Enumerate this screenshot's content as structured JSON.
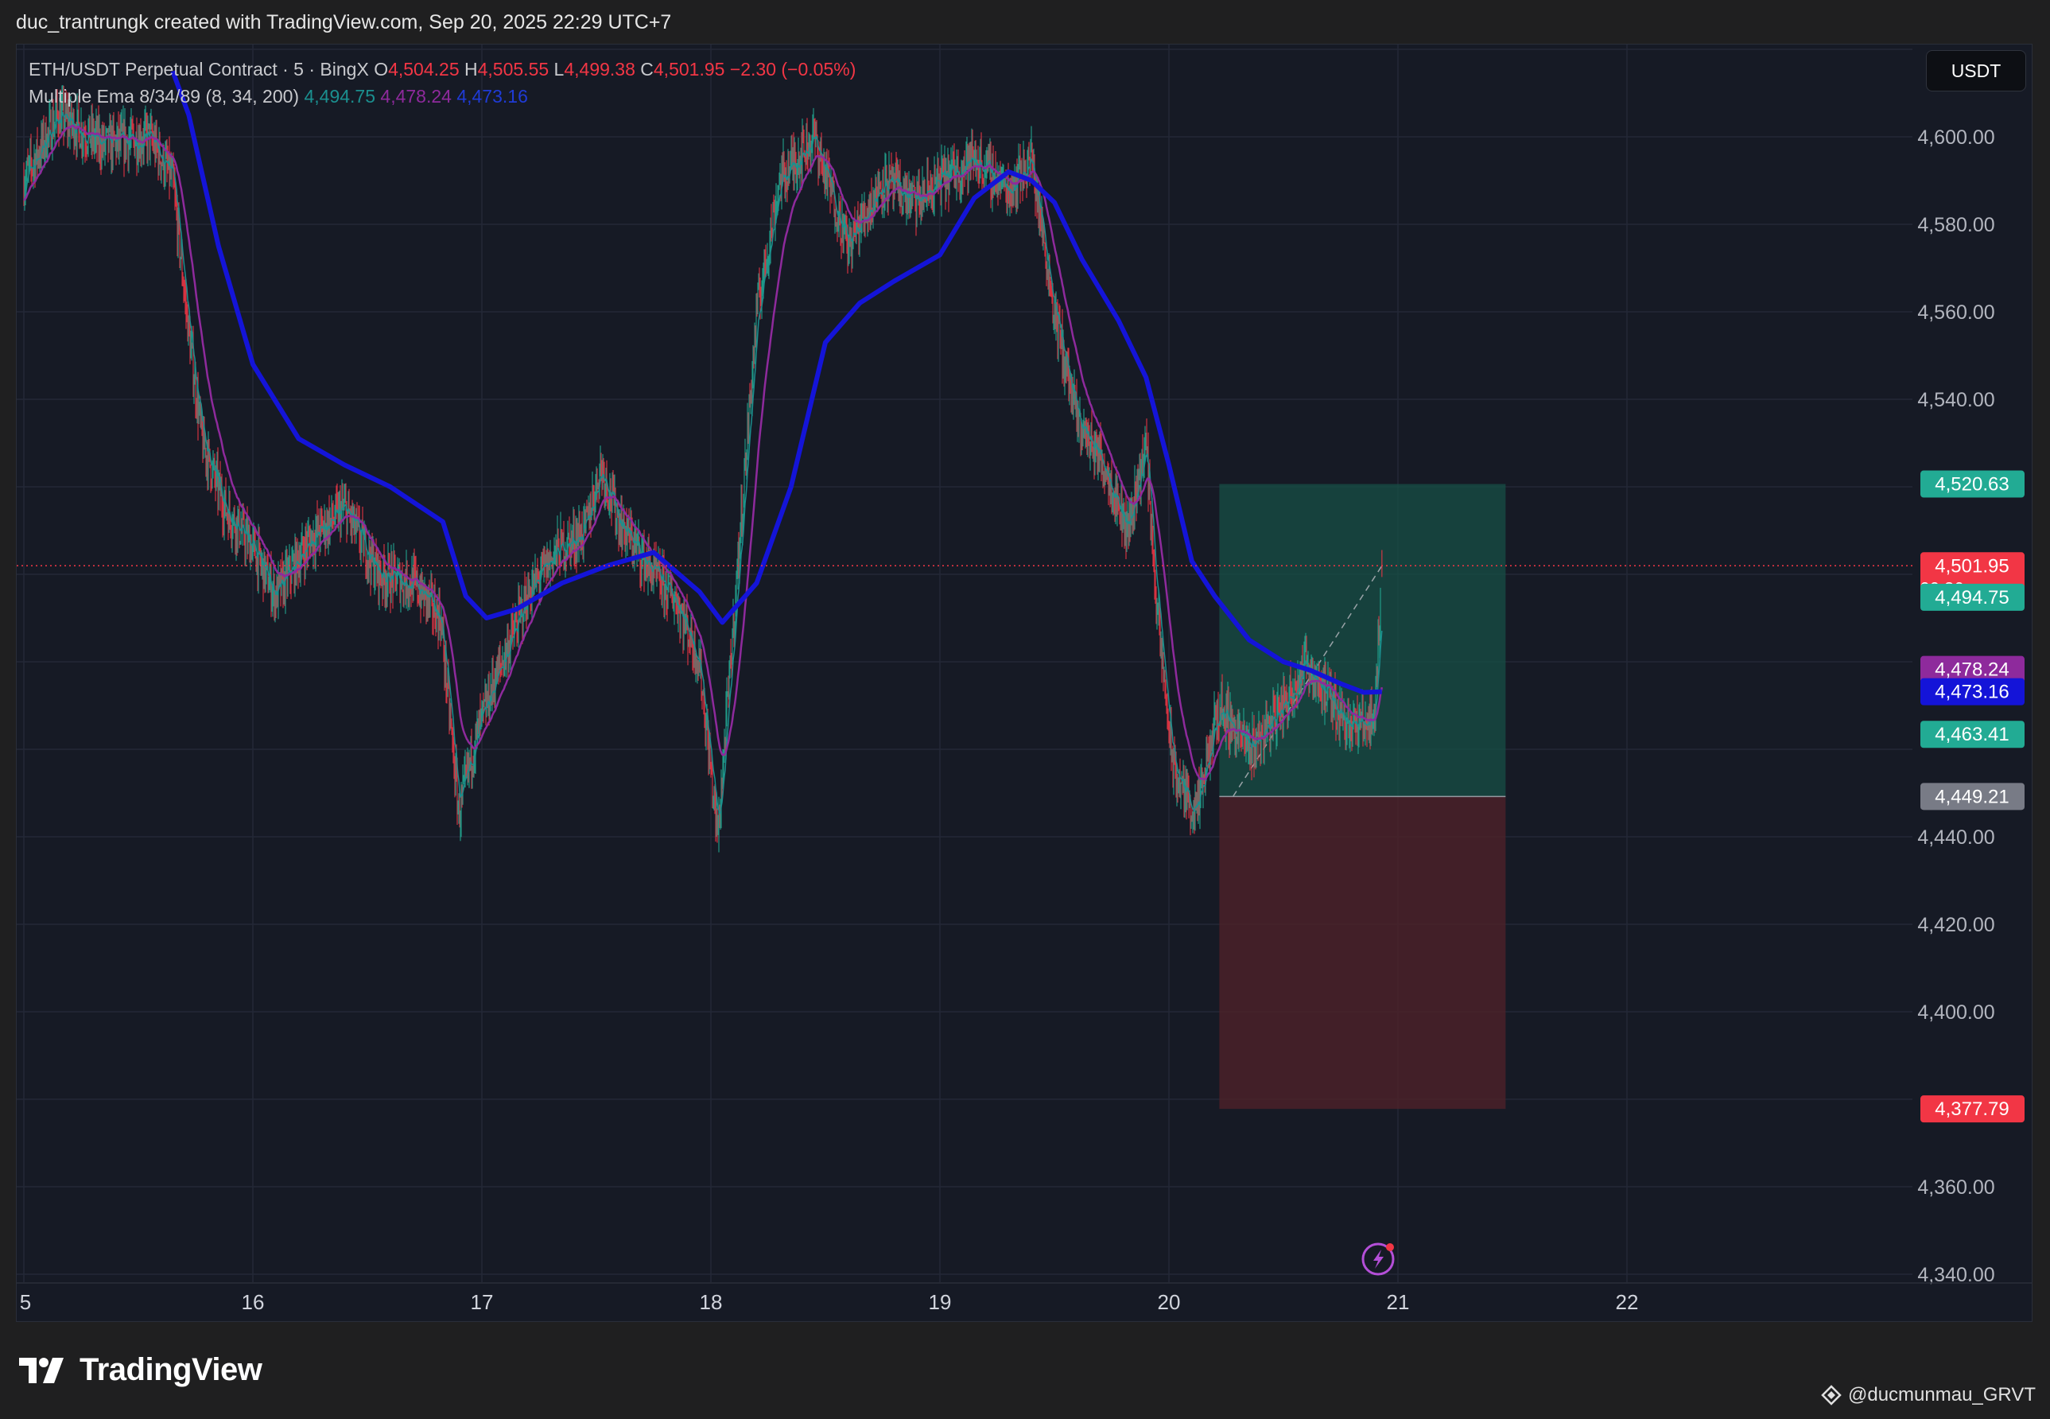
{
  "header": {
    "credit": "duc_trantrungk created with TradingView.com, Sep 20, 2025 22:29 UTC+7"
  },
  "legend": {
    "symbol": "ETH/USDT Perpetual Contract · 5 · BingX",
    "o_label": "O",
    "o_value": "4,504.25",
    "h_label": "H",
    "h_value": "4,505.55",
    "l_label": "L",
    "l_value": "4,499.38",
    "c_label": "C",
    "c_value": "4,501.95",
    "change": "−2.30 (−0.05%)",
    "indicator": "Multiple Ema 8/34/89 (8, 34, 200)",
    "ema1": "4,494.75",
    "ema2": "4,478.24",
    "ema3": "4,473.16"
  },
  "currency_badge": "USDT",
  "brand": {
    "logo_text": "TradingView"
  },
  "watermark": "@ducmunmau_GRVT",
  "colors": {
    "up": "#22ab94",
    "down": "#f23645",
    "ema_fast": "#1b8f8f",
    "ema_mid": "#8e2a9c",
    "ema_slow": "#1414d8",
    "profit_zone": "#174f45",
    "loss_zone": "#4a2129"
  },
  "chart_data": {
    "type": "candlestick",
    "title": "ETH/USDT Perpetual Contract · 5 · BingX",
    "timeframe": "5",
    "xlabel": "",
    "ylabel": "",
    "x_ticks": [
      "5",
      "16",
      "17",
      "18",
      "19",
      "20",
      "21",
      "22"
    ],
    "x_range_days": [
      15,
      22.3
    ],
    "ylim": [
      4332,
      4615
    ],
    "y_ticks": [
      4600,
      4580,
      4560,
      4540,
      4440,
      4420,
      4400,
      4360,
      4340
    ],
    "y_tick_labels": [
      "4,600.00",
      "4,580.00",
      "4,560.00",
      "4,540.00",
      "4,440.00",
      "4,420.00",
      "4,400.00",
      "4,360.00",
      "4,340.00"
    ],
    "grid": true,
    "price_path": [
      [
        15.0,
        4590
      ],
      [
        15.15,
        4605
      ],
      [
        15.35,
        4598
      ],
      [
        15.55,
        4600
      ],
      [
        15.65,
        4590
      ],
      [
        15.72,
        4555
      ],
      [
        15.78,
        4530
      ],
      [
        15.88,
        4515
      ],
      [
        16.0,
        4506
      ],
      [
        16.1,
        4495
      ],
      [
        16.25,
        4508
      ],
      [
        16.4,
        4515
      ],
      [
        16.55,
        4500
      ],
      [
        16.7,
        4498
      ],
      [
        16.82,
        4490
      ],
      [
        16.9,
        4445
      ],
      [
        16.96,
        4460
      ],
      [
        17.05,
        4475
      ],
      [
        17.2,
        4495
      ],
      [
        17.32,
        4505
      ],
      [
        17.45,
        4510
      ],
      [
        17.52,
        4525
      ],
      [
        17.6,
        4512
      ],
      [
        17.75,
        4500
      ],
      [
        17.85,
        4494
      ],
      [
        17.95,
        4480
      ],
      [
        18.03,
        4440
      ],
      [
        18.1,
        4490
      ],
      [
        18.2,
        4560
      ],
      [
        18.3,
        4590
      ],
      [
        18.45,
        4600
      ],
      [
        18.6,
        4575
      ],
      [
        18.75,
        4590
      ],
      [
        18.9,
        4585
      ],
      [
        19.0,
        4590
      ],
      [
        19.15,
        4595
      ],
      [
        19.3,
        4588
      ],
      [
        19.4,
        4595
      ],
      [
        19.5,
        4560
      ],
      [
        19.6,
        4535
      ],
      [
        19.72,
        4525
      ],
      [
        19.82,
        4510
      ],
      [
        19.9,
        4530
      ],
      [
        19.95,
        4490
      ],
      [
        20.02,
        4455
      ],
      [
        20.12,
        4445
      ],
      [
        20.22,
        4470
      ],
      [
        20.35,
        4460
      ],
      [
        20.5,
        4470
      ],
      [
        20.6,
        4480
      ],
      [
        20.72,
        4470
      ],
      [
        20.82,
        4465
      ],
      [
        20.9,
        4468
      ],
      [
        20.93,
        4501.95
      ]
    ],
    "series": [
      {
        "name": "ETH/USDT Perpetual Contract · 5 · BingX",
        "last": 4501.95,
        "ohlc": {
          "open": 4504.25,
          "high": 4505.55,
          "low": 4499.38,
          "close": 4501.95
        },
        "change": -2.3,
        "change_pct": -0.05
      },
      {
        "name": "EMA 8",
        "last": 4494.75
      },
      {
        "name": "EMA 34",
        "last": 4478.24
      },
      {
        "name": "EMA 200",
        "last": 4473.16,
        "x": [
          15.65,
          15.72,
          15.85,
          16.0,
          16.2,
          16.4,
          16.6,
          16.83,
          16.93,
          17.02,
          17.15,
          17.35,
          17.55,
          17.75,
          17.95,
          18.05,
          18.2,
          18.35,
          18.5,
          18.65,
          18.8,
          19.0,
          19.15,
          19.3,
          19.4,
          19.5,
          19.62,
          19.78,
          19.9,
          20.0,
          20.1,
          20.2,
          20.35,
          20.5,
          20.62,
          20.75,
          20.85,
          20.93
        ],
        "values": [
          4615,
          4605,
          4575,
          4548,
          4531,
          4525,
          4520,
          4512,
          4495,
          4490,
          4492,
          4498,
          4502,
          4505,
          4496,
          4489,
          4498,
          4520,
          4553,
          4562,
          4567,
          4573,
          4586,
          4592,
          4590,
          4585,
          4572,
          4558,
          4545,
          4525,
          4503,
          4495,
          4485,
          4480,
          4478,
          4475,
          4473,
          4473.16
        ]
      }
    ],
    "position_tool": {
      "type": "long",
      "entry": 4449.21,
      "take_profit": 4520.63,
      "stop_loss": 4377.79,
      "start_day": 20.22,
      "end_day": 21.47
    },
    "price_labels": [
      {
        "value": 4520.63,
        "text": "4,520.63",
        "color": "#22ab94"
      },
      {
        "value": 4501.95,
        "text": "4,501.95",
        "sub": "00:36",
        "color": "#f23645"
      },
      {
        "value": 4494.75,
        "text": "4,494.75",
        "color": "#22ab94"
      },
      {
        "value": 4478.24,
        "text": "4,478.24",
        "color": "#8e2a9c"
      },
      {
        "value": 4473.16,
        "text": "4,473.16",
        "color": "#1414d8"
      },
      {
        "value": 4463.41,
        "text": "4,463.41",
        "color": "#22ab94"
      },
      {
        "value": 4449.21,
        "text": "4,449.21",
        "color": "#787b86"
      },
      {
        "value": 4377.79,
        "text": "4,377.79",
        "color": "#f23645"
      }
    ],
    "legend_position": "top-left"
  }
}
